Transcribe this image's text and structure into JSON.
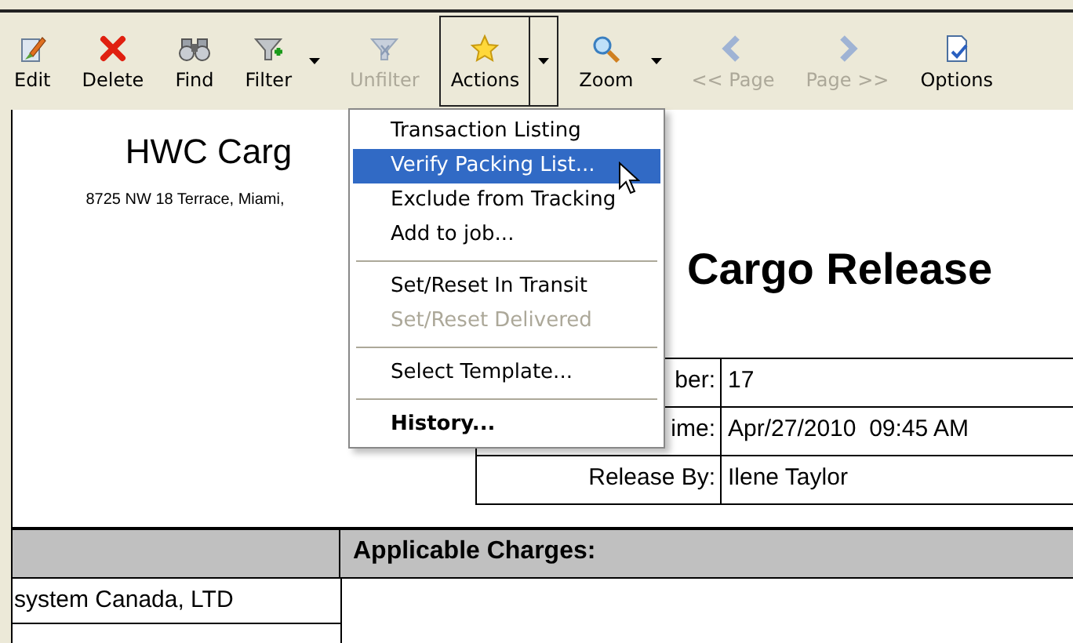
{
  "toolbar": {
    "buttons": [
      {
        "label": "Edit",
        "disabled": false,
        "pressed": false,
        "dropdown": false
      },
      {
        "label": "Delete",
        "disabled": false,
        "pressed": false,
        "dropdown": false
      },
      {
        "label": "Find",
        "disabled": false,
        "pressed": false,
        "dropdown": false
      },
      {
        "label": "Filter",
        "disabled": false,
        "pressed": false,
        "dropdown": true
      },
      {
        "label": "Unfilter",
        "disabled": true,
        "pressed": false,
        "dropdown": false
      },
      {
        "label": "Actions",
        "disabled": false,
        "pressed": true,
        "dropdown": true
      },
      {
        "label": "Zoom",
        "disabled": false,
        "pressed": false,
        "dropdown": true
      },
      {
        "label": "<< Page",
        "disabled": true,
        "pressed": false,
        "dropdown": false
      },
      {
        "label": "Page >>",
        "disabled": true,
        "pressed": false,
        "dropdown": false
      },
      {
        "label": "Options",
        "disabled": false,
        "pressed": false,
        "dropdown": false
      }
    ]
  },
  "menu": {
    "groups": [
      [
        {
          "label": "Transaction Listing",
          "selected": false,
          "disabled": false,
          "default": false
        },
        {
          "label": "Verify Packing List...",
          "selected": true,
          "disabled": false,
          "default": false
        },
        {
          "label": "Exclude from Tracking",
          "selected": false,
          "disabled": false,
          "default": false
        },
        {
          "label": "Add to job...",
          "selected": false,
          "disabled": false,
          "default": false
        }
      ],
      [
        {
          "label": "Set/Reset In Transit",
          "selected": false,
          "disabled": false,
          "default": false
        },
        {
          "label": "Set/Reset Delivered",
          "selected": false,
          "disabled": true,
          "default": false
        }
      ],
      [
        {
          "label": "Select Template...",
          "selected": false,
          "disabled": false,
          "default": false
        }
      ],
      [
        {
          "label": "History...",
          "selected": false,
          "disabled": false,
          "default": true
        }
      ]
    ]
  },
  "document": {
    "company_name": "HWC Carg",
    "address": "8725 NW 18 Terrace, Miami,",
    "title": "Cargo Release",
    "info_rows": [
      {
        "label": "ber:",
        "value": "17"
      },
      {
        "label": "ime:",
        "value": "Apr/27/2010  09:45 AM"
      },
      {
        "label": "Release By:",
        "value": "Ilene Taylor"
      }
    ],
    "charges_header": "Applicable Charges:",
    "left_cell": "system Canada, LTD"
  }
}
